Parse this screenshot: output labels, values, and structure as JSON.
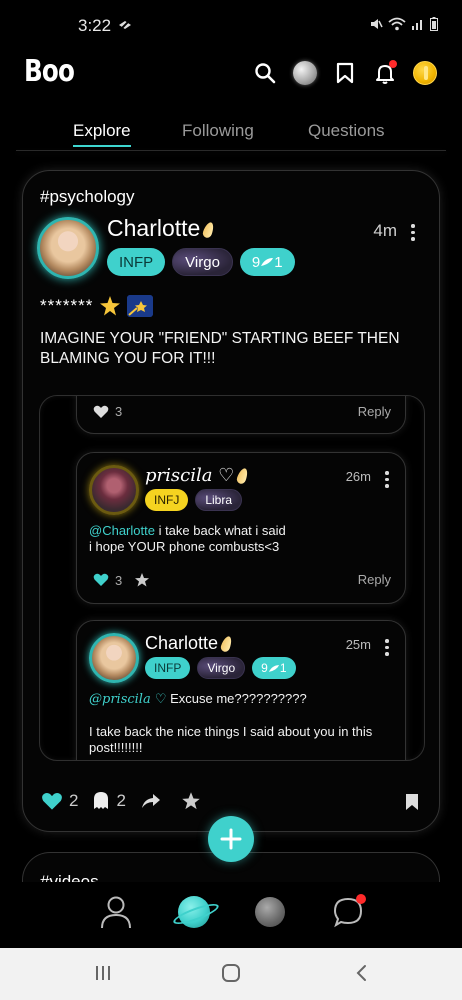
{
  "status_bar": {
    "time": "3:22"
  },
  "header": {
    "brand": "Boo"
  },
  "tabs": [
    {
      "label": "Explore",
      "active": true
    },
    {
      "label": "Following",
      "active": false
    },
    {
      "label": "Questions",
      "active": false
    }
  ],
  "post": {
    "tag": "#psychology",
    "author": "Charlotte",
    "time": "4m",
    "badges": {
      "mbti": "INFP",
      "zodiac": "Virgo",
      "score": "9"
    },
    "stars_line": "*******",
    "text": "IMAGINE YOUR \"FRIEND\" STARTING BEEF THEN BLAMING YOU FOR IT!!!",
    "likes": "2",
    "ghosts": "2"
  },
  "comments": [
    {
      "likes": "3",
      "reply_label": "Reply"
    },
    {
      "author": "priscila ♡",
      "time": "26m",
      "badges": {
        "mbti": "INFJ",
        "zodiac": "Libra"
      },
      "mention": "@Charlotte",
      "text_line1": " i take back what i said",
      "text_line2": "i hope YOUR phone combusts<3",
      "likes": "3",
      "reply_label": "Reply"
    },
    {
      "author": "Charlotte",
      "time": "25m",
      "badges": {
        "mbti": "INFP",
        "zodiac": "Virgo",
        "score": "9"
      },
      "mention": "@priscila ♡",
      "text_line1": " Excuse me??????????",
      "text_line2": "I take back the nice things I said about you in this post!!!!!!!!"
    }
  ],
  "next_post": {
    "tag": "#videos"
  },
  "colors": {
    "accent": "#3fd1cc",
    "infj": "#f5d320",
    "notification": "#ff2a2a"
  }
}
